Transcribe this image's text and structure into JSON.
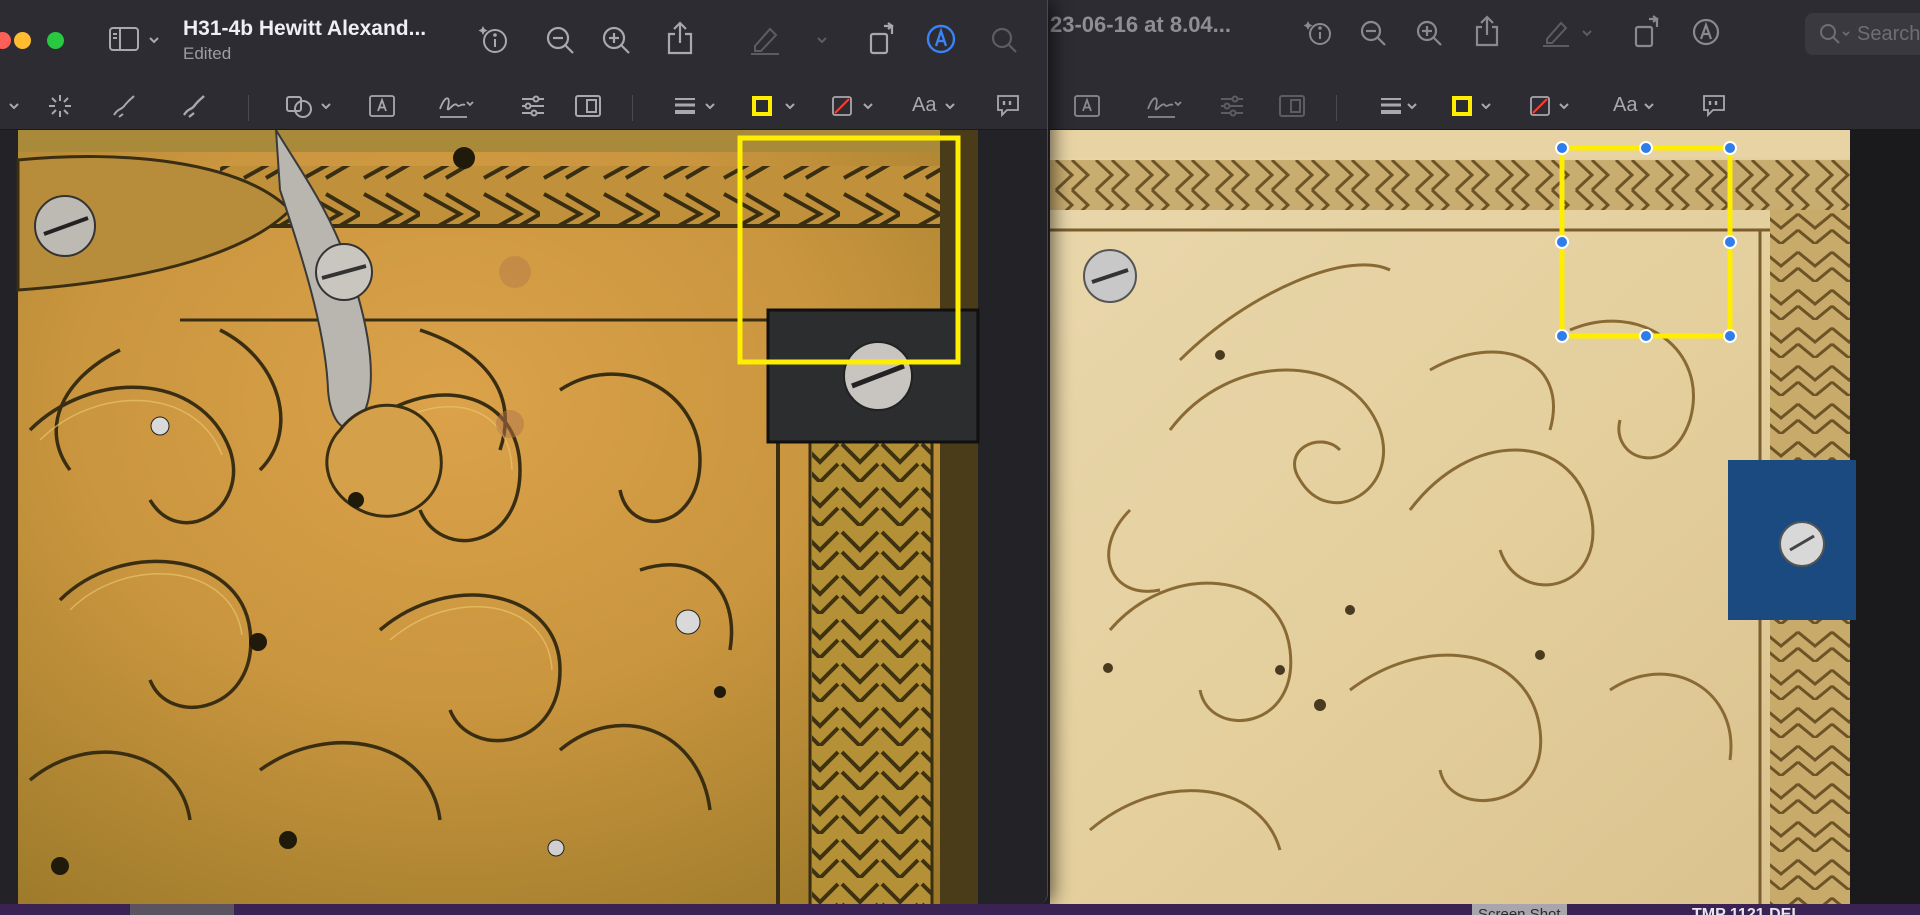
{
  "front_window": {
    "title": "H31-4b Hewitt Alexand...",
    "subtitle": "Edited",
    "traffic_lights": [
      "#fe5f57",
      "#febc2e",
      "#28c840"
    ],
    "toolbar_icons": [
      "sidebar-icon",
      "info-icon",
      "zoom-out-icon",
      "zoom-in-icon",
      "share-icon",
      "highlight-icon",
      "rotate-icon",
      "markup-icon",
      "search-icon"
    ],
    "markup_icons": [
      "instant-alpha-icon",
      "sketch-icon",
      "draw-icon",
      "shapes-icon",
      "text-box-icon",
      "sign-icon",
      "adjust-color-icon",
      "adjust-size-icon",
      "shape-style-icon",
      "border-color-icon",
      "fill-color-icon",
      "text-style-icon",
      "description-icon"
    ],
    "text_style_label": "Aa",
    "annotation_color": "#ffee00",
    "markup_accent": "#3b82f6"
  },
  "back_window": {
    "title_fragment": "23-06-16 at 8.04...",
    "search_placeholder": "Search",
    "text_style_label": "Aa",
    "toolbar_icons": [
      "info-icon",
      "zoom-out-icon",
      "zoom-in-icon",
      "share-icon",
      "highlight-icon",
      "rotate-icon",
      "markup-icon",
      "search-icon"
    ],
    "selection_handle_color": "#2f7de8"
  },
  "dock": {
    "items": [
      "Screen Shot",
      "TMP 1121 DEL"
    ]
  }
}
